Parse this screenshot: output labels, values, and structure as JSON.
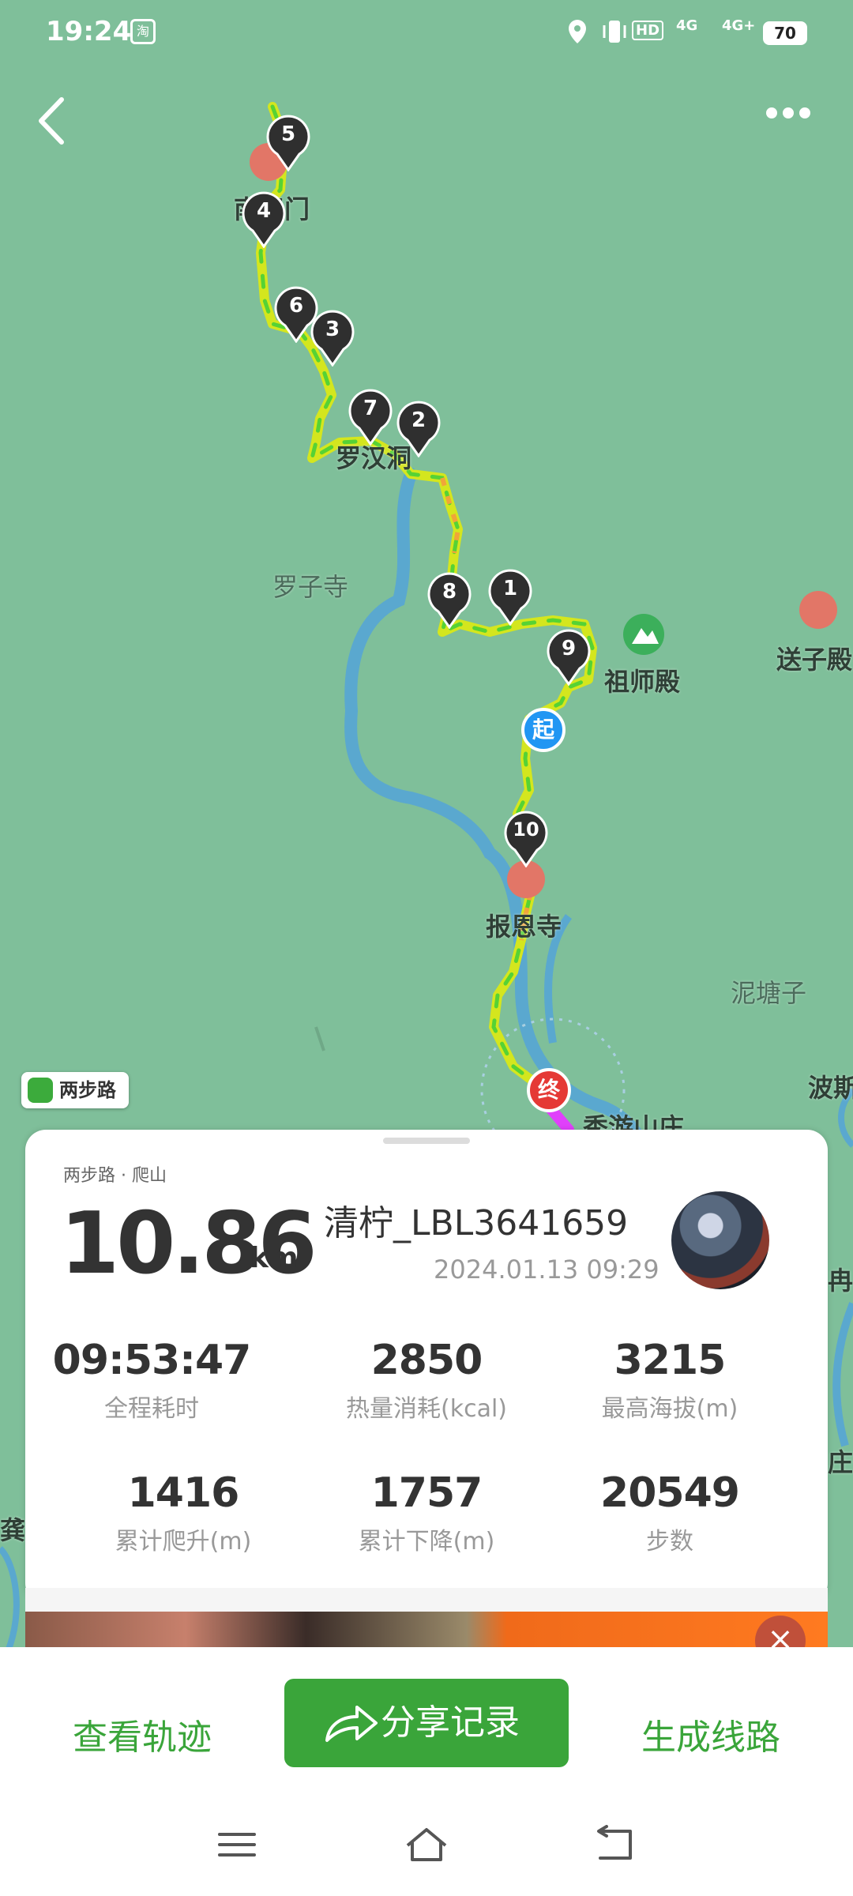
{
  "status_bar": {
    "time": "19:24",
    "taobao_icon": "淘",
    "network_hd": "HD",
    "network_4g": "4G",
    "network_4g_plus": "4G+",
    "battery": "70"
  },
  "map": {
    "labels": {
      "nantianmen": "南天门",
      "luohandong": "罗汉洞",
      "luozisi": "罗子寺",
      "zushidian": "祖师殿",
      "songzidian": "送子殿",
      "baoensi": "报恩寺",
      "nitangzi": "泥塘子",
      "bosi": "波斯",
      "xiuyoushanzhuang": "秀游山庄",
      "edge_ran": "冉",
      "edge_zhuang": "庄",
      "edge_gong": "龚"
    },
    "markers": [
      "1",
      "2",
      "3",
      "4",
      "5",
      "6",
      "7",
      "8",
      "9",
      "10"
    ],
    "start_label": "起",
    "end_label": "终"
  },
  "brand_badge": "两步路",
  "record": {
    "category": "两步路 · 爬山",
    "distance_value": "10.86",
    "distance_unit": "km",
    "username": "清柠_LBL3641659",
    "date": "2024.01.13 09:29",
    "stats": [
      {
        "value": "09:53:47",
        "label": "全程耗时"
      },
      {
        "value": "2850",
        "label": "热量消耗(kcal)"
      },
      {
        "value": "3215",
        "label": "最高海拔(m)"
      },
      {
        "value": "1416",
        "label": "累计爬升(m)"
      },
      {
        "value": "1757",
        "label": "累计下降(m)"
      },
      {
        "value": "20549",
        "label": "步数"
      }
    ]
  },
  "actions": {
    "view_track": "查看轨迹",
    "share": "分享记录",
    "generate_route": "生成线路"
  },
  "icons": {
    "back": "chevron-left-icon",
    "more": "more-icon",
    "share": "share-arrow-icon",
    "nav_menu": "menu-icon",
    "nav_home": "home-icon",
    "nav_back": "back-icon"
  },
  "colors": {
    "map_bg": "#7fbf9a",
    "river": "#5aa8cf",
    "accent_green": "#3aa53a",
    "start_blue": "#2196f3",
    "end_red": "#e53935"
  }
}
